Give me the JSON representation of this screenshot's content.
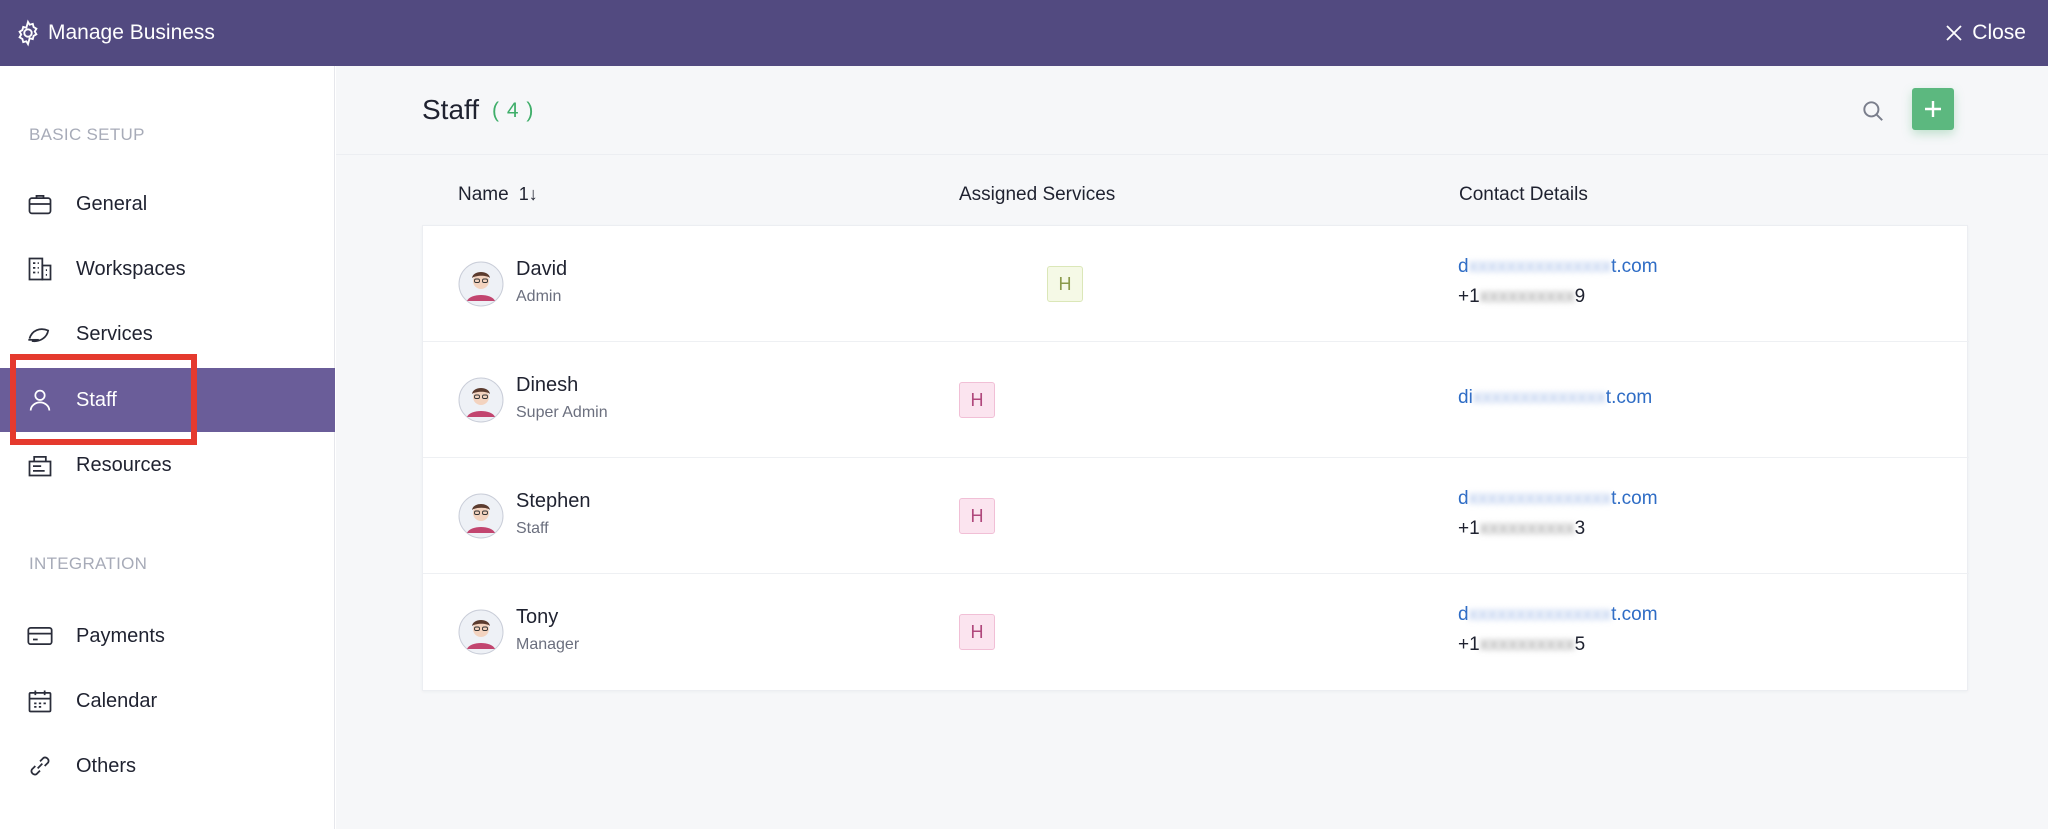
{
  "topbar": {
    "title": "Manage Business",
    "close_label": "Close",
    "bg_color": "#524a80"
  },
  "sidebar": {
    "sections": [
      {
        "label": "BASIC SETUP"
      },
      {
        "label": "INTEGRATION"
      }
    ],
    "items": [
      {
        "label": "General",
        "icon": "briefcase-icon"
      },
      {
        "label": "Workspaces",
        "icon": "building-icon"
      },
      {
        "label": "Services",
        "icon": "service-icon"
      },
      {
        "label": "Staff",
        "icon": "staff-icon",
        "active": true
      },
      {
        "label": "Resources",
        "icon": "resources-icon"
      },
      {
        "label": "Payments",
        "icon": "credit-card-icon"
      },
      {
        "label": "Calendar",
        "icon": "calendar-icon"
      },
      {
        "label": "Others",
        "icon": "link-icon"
      }
    ],
    "active_color": "#6a5d99",
    "highlight_color": "#e53a2e"
  },
  "main": {
    "title": "Staff",
    "count": "( 4 )",
    "columns": {
      "name": "Name",
      "sort_indicator": "1↓",
      "services": "Assigned Services",
      "contact": "Contact Details"
    },
    "staff": [
      {
        "name": "David",
        "role": "Admin",
        "service_badge": "H",
        "email_start": "d",
        "email_mid": "xxxxxxxxxxxxxxx",
        "email_end": "t.com",
        "phone_start": "+1",
        "phone_mid": "xxxxxxxxxx",
        "phone_end": "9"
      },
      {
        "name": "Dinesh",
        "role": "Super Admin",
        "service_badge": "H",
        "email_start": "di",
        "email_mid": "xxxxxxxxxxxxxx",
        "email_end": "t.com",
        "phone_start": "",
        "phone_mid": "",
        "phone_end": ""
      },
      {
        "name": "Stephen",
        "role": "Staff",
        "service_badge": "H",
        "email_start": "d",
        "email_mid": "xxxxxxxxxxxxxxx",
        "email_end": "t.com",
        "phone_start": "+1",
        "phone_mid": "xxxxxxxxxx",
        "phone_end": "3"
      },
      {
        "name": "Tony",
        "role": "Manager",
        "service_badge": "H",
        "email_start": "d",
        "email_mid": "xxxxxxxxxxxxxxx",
        "email_end": "t.com",
        "phone_start": "+1",
        "phone_mid": "xxxxxxxxxx",
        "phone_end": "5"
      }
    ],
    "accent_color": "#5cb87f"
  }
}
